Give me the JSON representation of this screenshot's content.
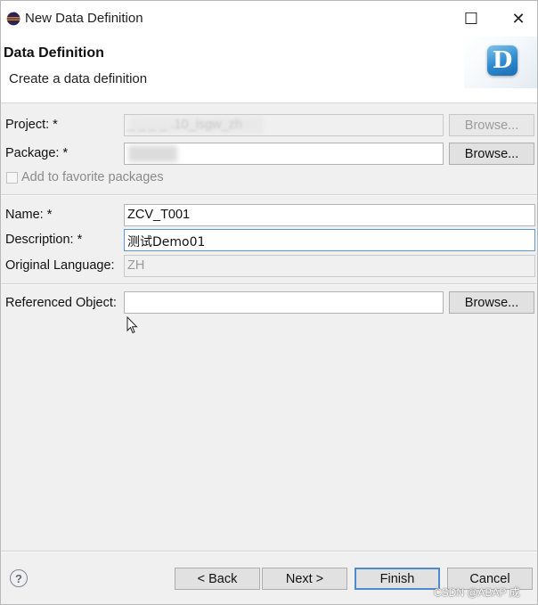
{
  "window": {
    "title": "New Data Definition",
    "close_glyph": "✕",
    "maximize_glyph": "☐",
    "icon": "eclipse-icon"
  },
  "banner": {
    "title": "Data Definition",
    "subtitle": "Create a data definition",
    "logo_letter": "D",
    "logo_icon": "data-definition-logo-icon"
  },
  "form": {
    "project": {
      "label": "Project: *",
      "value": "_ _ _ _ .10_isgw_zh",
      "browse_label": "Browse..."
    },
    "package": {
      "label": "Package: *",
      "value": "",
      "browse_label": "Browse..."
    },
    "favorite": {
      "label": "Add to favorite packages",
      "checked": false
    },
    "name": {
      "label": "Name: *",
      "value": "ZCV_T001"
    },
    "description": {
      "label": "Description: *",
      "value": "测试Demo01"
    },
    "original_language": {
      "label": "Original Language:",
      "value": "ZH"
    },
    "referenced_object": {
      "label": "Referenced Object:",
      "value": "",
      "browse_label": "Browse..."
    }
  },
  "footer": {
    "help_glyph": "?",
    "back_label": "< Back",
    "next_label": "Next >",
    "finish_label": "Finish",
    "cancel_label": "Cancel"
  },
  "watermark": "CSDN @ABAP 成",
  "colors": {
    "accent": "#4d8ad0",
    "focus_border": "#5a9ad6",
    "logo": "#2c8ad0",
    "window_bg": "#f0f0f0"
  }
}
